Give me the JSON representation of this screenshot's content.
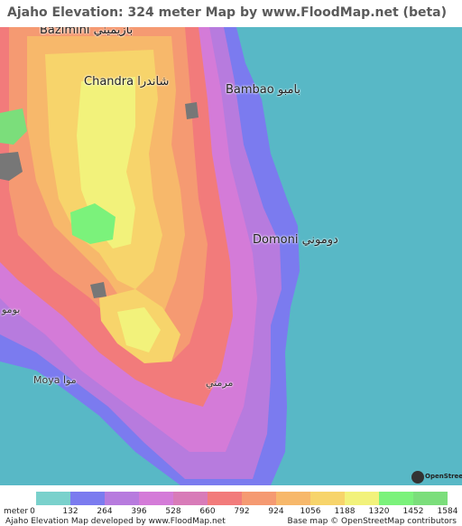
{
  "title": "Ajaho Elevation: 324 meter Map by www.FloodMap.net (beta)",
  "places": [
    {
      "name": "Bazimini بازيميني"
    },
    {
      "name": "Chandra شاندرا"
    },
    {
      "name": "Bambao بامبو"
    },
    {
      "name": "Domoni دوموني"
    },
    {
      "name": "بومو"
    },
    {
      "name": "Moya موا"
    },
    {
      "name": "مرمتي"
    }
  ],
  "osm_logo_text": "OpenStreetMap",
  "legend": {
    "unit": "meter",
    "ticks": [
      "0",
      "132",
      "264",
      "396",
      "528",
      "660",
      "792",
      "924",
      "1056",
      "1188",
      "1320",
      "1452",
      "1584"
    ],
    "colors": [
      "#7ad1cc",
      "#7b7bef",
      "#b77bde",
      "#d47bd8",
      "#d87bb8",
      "#f27b7b",
      "#f59a72",
      "#f7b86b",
      "#f7d46b",
      "#f2f27b",
      "#7bf27b",
      "#7bde7b"
    ]
  },
  "footer": {
    "left": "Ajaho Elevation Map developed by www.FloodMap.net",
    "right": "Base map © OpenStreetMap contributors"
  },
  "colors": {
    "sea": "#58b8c6",
    "coast": "#7b7bef",
    "lowland": "#b77bde",
    "mid": "#f27b7b",
    "high": "#f7d46b",
    "peak": "#7bde7b"
  }
}
